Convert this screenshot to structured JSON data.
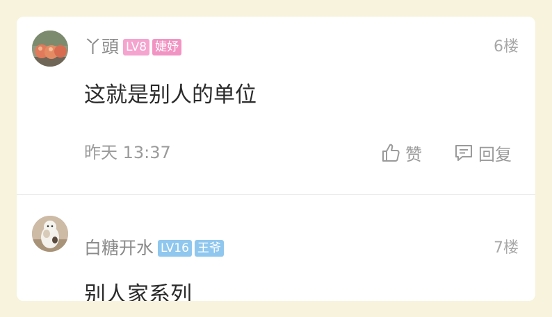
{
  "comments": [
    {
      "username": "丫頭",
      "level": "LV8",
      "title_badge": "婕妤",
      "floor": "6楼",
      "content": "这就是别人的单位",
      "time": "昨天 13:37",
      "like_label": "赞",
      "reply_label": "回复",
      "badge_colors": {
        "level": "#f5a3cf",
        "title": "#f294c3"
      }
    },
    {
      "username": "白糖开水",
      "level": "LV16",
      "title_badge": "王爷",
      "floor": "7楼",
      "content": "别人家系列",
      "badge_colors": {
        "level": "#8fc7ee",
        "title": "#8fc7ee"
      }
    }
  ],
  "icons": {
    "like": "thumbs-up-icon",
    "reply": "comment-bubble-icon"
  }
}
